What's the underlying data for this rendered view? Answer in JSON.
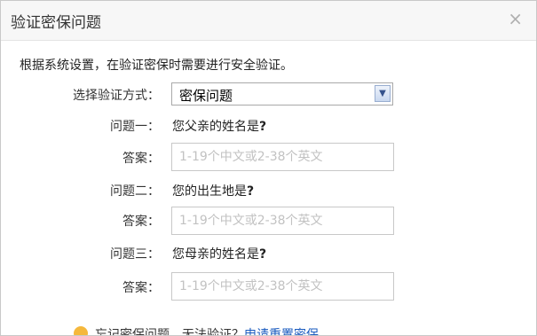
{
  "dialog": {
    "title": "验证密保问题",
    "close_glyph": "×",
    "intro": "根据系统设置，在验证密保时需要进行安全验证。"
  },
  "method": {
    "label": "选择验证方式：",
    "selected": "密保问题"
  },
  "questions": [
    {
      "label": "问题一：",
      "text": "您父亲的姓名是",
      "suffix": "?",
      "answer_label": "答案：",
      "placeholder": "1-19个中文或2-38个英文",
      "value": ""
    },
    {
      "label": "问题二：",
      "text": "您的出生地是",
      "suffix": "?",
      "answer_label": "答案：",
      "placeholder": "1-19个中文或2-38个英文",
      "value": ""
    },
    {
      "label": "问题三：",
      "text": "您母亲的姓名是",
      "suffix": "?",
      "answer_label": "答案：",
      "placeholder": "1-19个中文或2-38个英文",
      "value": ""
    }
  ],
  "footer": {
    "text": "忘记密保问题，无法验证？",
    "link": "申请重置密保"
  }
}
